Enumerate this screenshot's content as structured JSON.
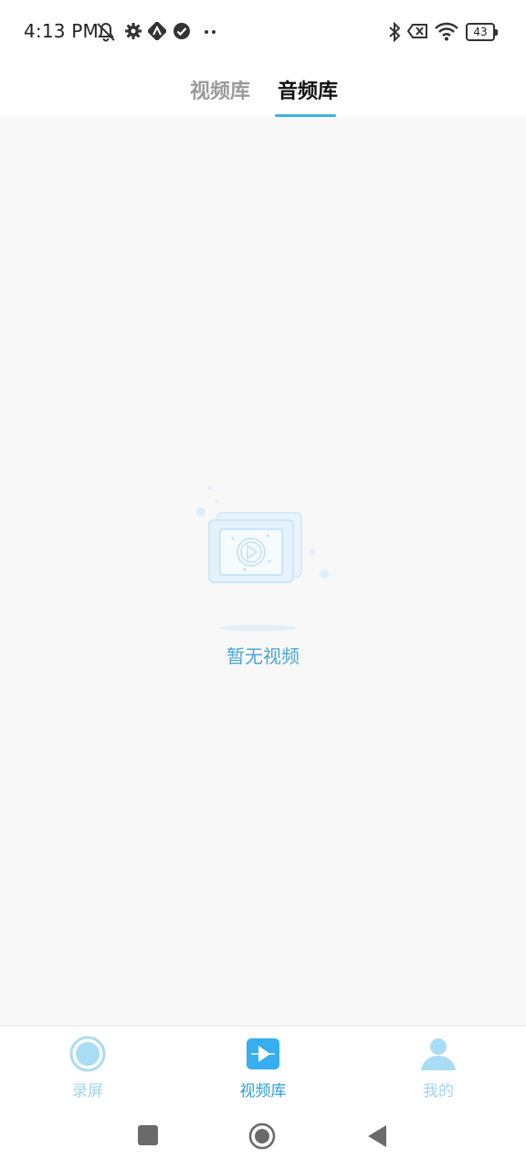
{
  "status_bar": {
    "time": "4:13 PM",
    "battery": "43",
    "icons": [
      "mute-icon",
      "gear-icon",
      "nfc-icon",
      "check-circle-icon",
      "more-dots-icon",
      "bluetooth-icon",
      "sim-off-icon",
      "wifi-icon",
      "battery-icon"
    ]
  },
  "tabs": [
    {
      "label": "视频库",
      "active": false
    },
    {
      "label": "音频库",
      "active": true
    }
  ],
  "empty_state": {
    "text": "暂无视频",
    "icon": "video-placeholder-icon"
  },
  "bottom_nav": {
    "items": [
      {
        "label": "录屏",
        "icon": "record-icon",
        "active": false
      },
      {
        "label": "视频库",
        "icon": "video-library-icon",
        "active": true
      },
      {
        "label": "我的",
        "icon": "person-icon",
        "active": false
      }
    ]
  },
  "colors": {
    "accent": "#3fb0e6",
    "nav_inactive": "#9fd4f0",
    "nav_active": "#2a9fdf",
    "content_bg": "#f8f8f8"
  }
}
